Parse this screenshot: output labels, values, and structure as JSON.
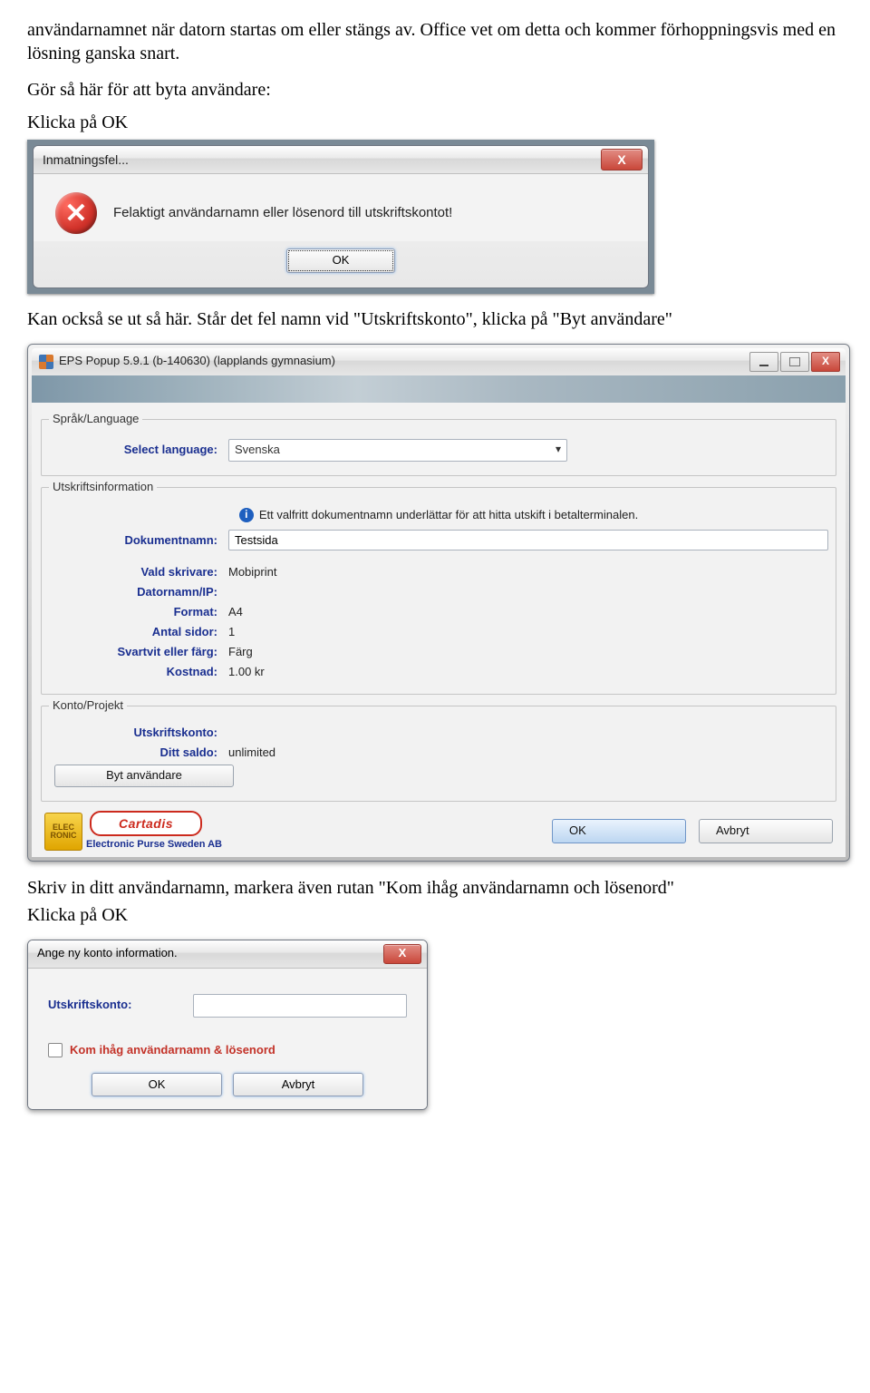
{
  "intro_para": "användarnamnet när datorn startas om eller stängs av. Office vet om detta och kommer förhoppningsvis med en lösning ganska snart.",
  "instr1": "Gör så här för att byta användare:",
  "instr2": "Klicka på OK",
  "dlg1": {
    "title": "Inmatningsfel...",
    "message": "Felaktigt användarnamn eller lösenord till utskriftskontot!",
    "ok": "OK",
    "close": "X"
  },
  "mid_text": "Kan också se ut så här. Står det fel namn vid \"Utskriftskonto\", klicka på \"Byt användare\"",
  "dlg2": {
    "title": "EPS Popup 5.9.1 (b-140630) (lapplands gymnasium)",
    "group_lang": "Språk/Language",
    "select_lang_label": "Select language:",
    "select_lang_value": "Svenska",
    "group_info": "Utskriftsinformation",
    "note": "Ett valfritt dokumentnamn underlättar för att hitta utskift i betalterminalen.",
    "docname_label": "Dokumentnamn:",
    "docname_value": "Testsida",
    "rows": {
      "printer_label": "Vald skrivare:",
      "printer_value": "Mobiprint",
      "host_label": "Datornamn/IP:",
      "host_value": "",
      "format_label": "Format:",
      "format_value": "A4",
      "pages_label": "Antal sidor:",
      "pages_value": "1",
      "color_label": "Svartvit eller färg:",
      "color_value": "Färg",
      "cost_label": "Kostnad:",
      "cost_value": "1.00 kr"
    },
    "group_acct": "Konto/Projekt",
    "acct_label": "Utskriftskonto:",
    "acct_value": "",
    "balance_label": "Ditt saldo:",
    "balance_value": "unlimited",
    "switch_user": "Byt användare",
    "brand2": "Cartadis",
    "brand_text": "Electronic Purse Sweden AB",
    "ok": "OK",
    "cancel": "Avbryt"
  },
  "out_text1": "Skriv in ditt användarnamn, markera även rutan \"Kom ihåg användarnamn och lösenord\"",
  "out_text2": "Klicka på OK",
  "dlg3": {
    "title": "Ange ny konto information.",
    "acct_label": "Utskriftskonto:",
    "remember": "Kom ihåg användarnamn & lösenord",
    "ok": "OK",
    "cancel": "Avbryt",
    "close": "X"
  }
}
